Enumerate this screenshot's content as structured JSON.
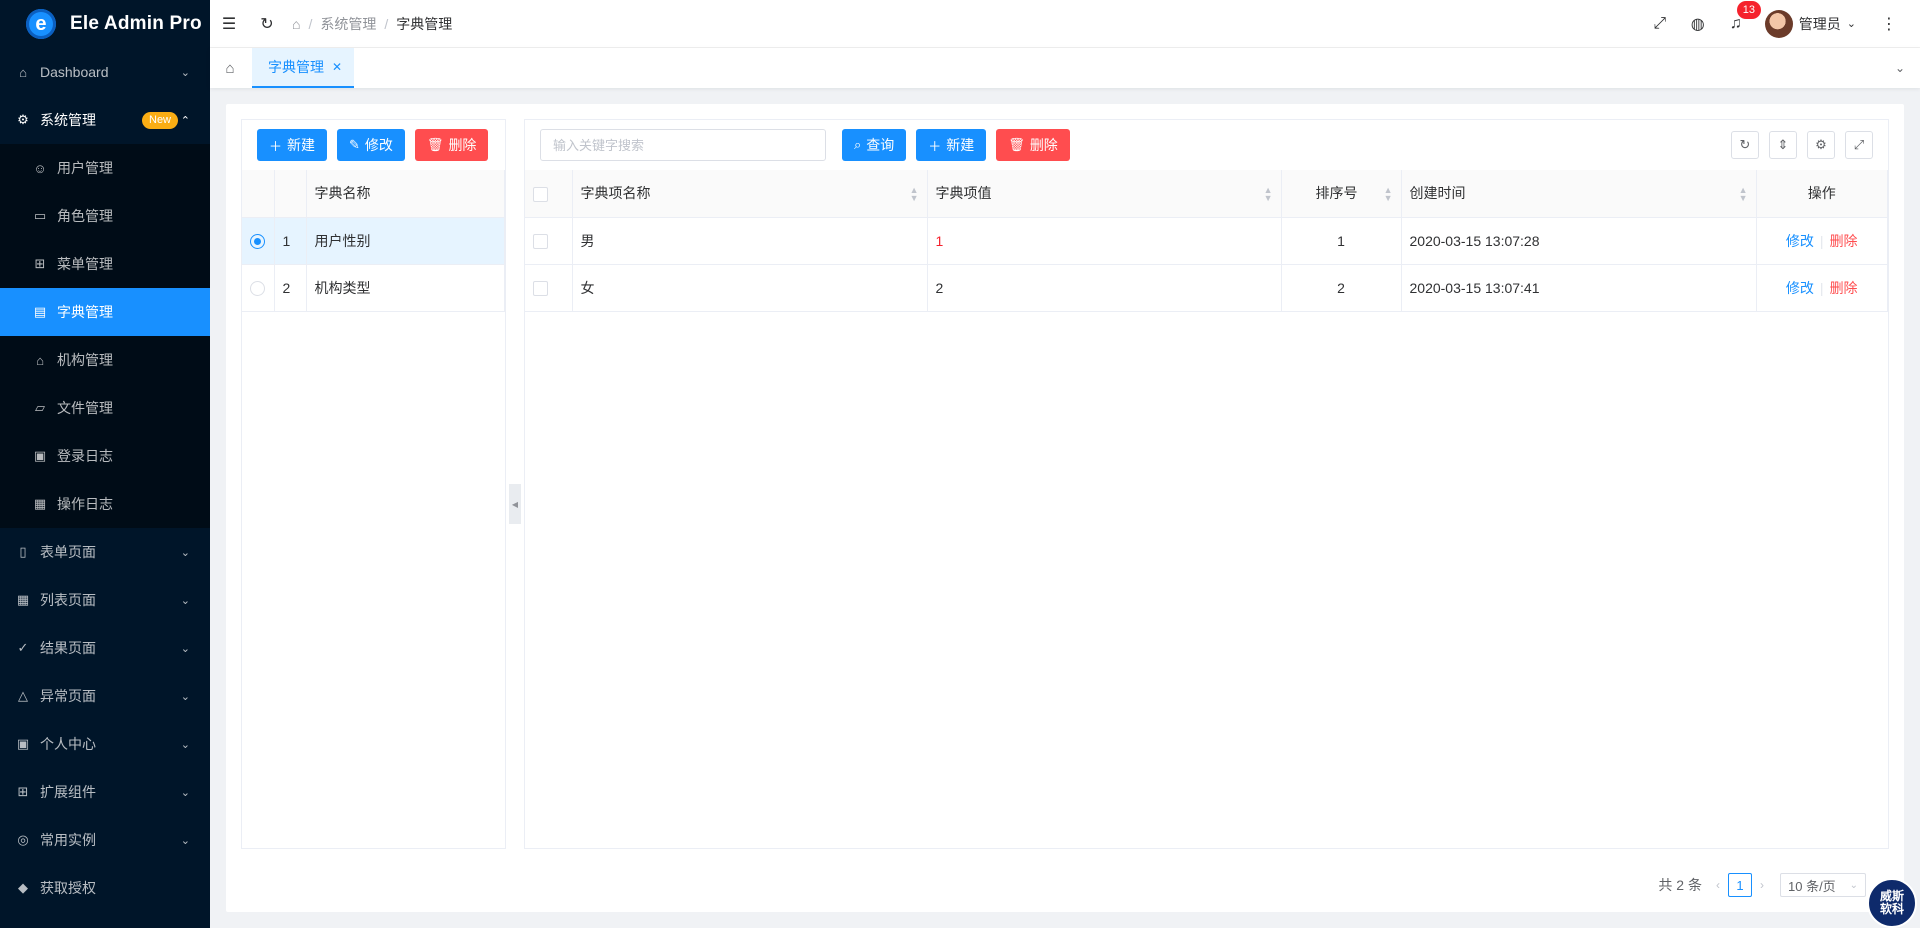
{
  "app": {
    "title": "Ele Admin Pro",
    "logo_letter": "e"
  },
  "sidebar": {
    "items": [
      {
        "label": "Dashboard",
        "icon": "home-icon"
      },
      {
        "label": "系统管理",
        "icon": "gear-icon",
        "badge": "New",
        "open": true,
        "children": [
          {
            "label": "用户管理",
            "icon": "users-icon"
          },
          {
            "label": "角色管理",
            "icon": "id-card-icon"
          },
          {
            "label": "菜单管理",
            "icon": "grid-icon"
          },
          {
            "label": "字典管理",
            "icon": "book-icon",
            "active": true
          },
          {
            "label": "机构管理",
            "icon": "bank-icon"
          },
          {
            "label": "文件管理",
            "icon": "folder-icon"
          },
          {
            "label": "登录日志",
            "icon": "calendar-icon"
          },
          {
            "label": "操作日志",
            "icon": "file-search-icon"
          }
        ]
      },
      {
        "label": "表单页面",
        "icon": "form-icon"
      },
      {
        "label": "列表页面",
        "icon": "table-icon"
      },
      {
        "label": "结果页面",
        "icon": "check-circle-icon"
      },
      {
        "label": "异常页面",
        "icon": "warning-icon"
      },
      {
        "label": "个人中心",
        "icon": "profile-icon"
      },
      {
        "label": "扩展组件",
        "icon": "component-icon"
      },
      {
        "label": "常用实例",
        "icon": "compass-icon"
      },
      {
        "label": "获取授权",
        "icon": "diamond-icon"
      }
    ]
  },
  "header": {
    "breadcrumb": [
      "系统管理",
      "字典管理"
    ],
    "notification_count": "13",
    "user_name": "管理员"
  },
  "tabs": [
    {
      "label": "字典管理",
      "active": true
    }
  ],
  "left_panel": {
    "buttons": {
      "add": "新建",
      "edit": "修改",
      "delete": "删除"
    },
    "column": "字典名称",
    "rows": [
      {
        "index": "1",
        "name": "用户性别",
        "selected": true
      },
      {
        "index": "2",
        "name": "机构类型",
        "selected": false
      }
    ]
  },
  "right_panel": {
    "search_placeholder": "输入关键字搜索",
    "buttons": {
      "query": "查询",
      "add": "新建",
      "delete": "删除"
    },
    "columns": {
      "name": "字典项名称",
      "value": "字典项值",
      "sort": "排序号",
      "created": "创建时间",
      "ops": "操作"
    },
    "rows": [
      {
        "name": "男",
        "value": "1",
        "sort": "1",
        "created": "2020-03-15 13:07:28"
      },
      {
        "name": "女",
        "value": "2",
        "sort": "2",
        "created": "2020-03-15 13:07:41"
      }
    ],
    "ops": {
      "edit": "修改",
      "delete": "删除"
    }
  },
  "pagination": {
    "total": "共 2 条",
    "current": "1",
    "page_size": "10 条/页"
  },
  "watermark": {
    "line1": "威斯",
    "line2": "软科"
  }
}
